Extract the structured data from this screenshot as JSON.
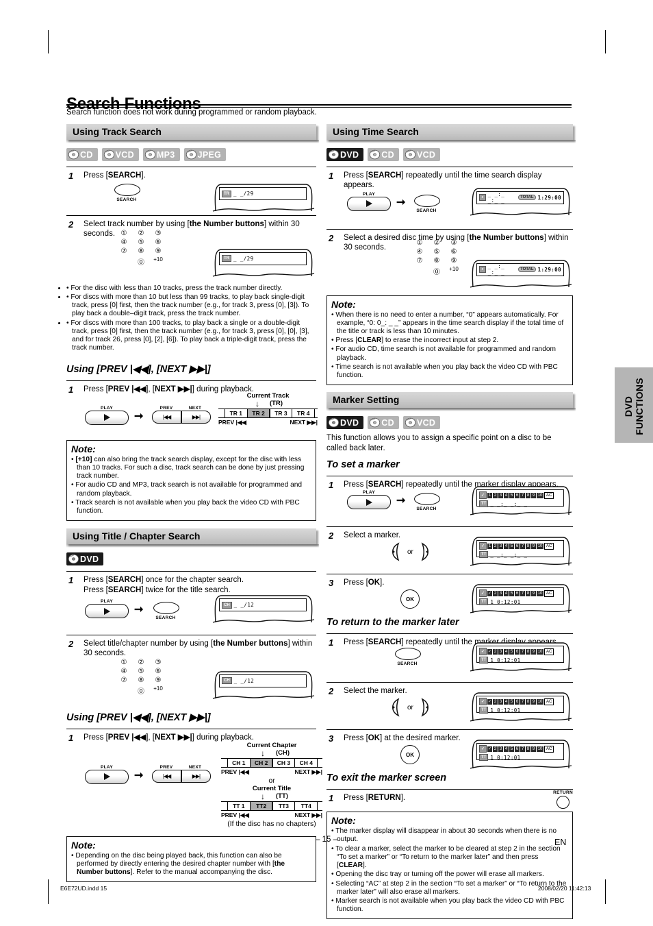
{
  "page": {
    "title": "Search Functions",
    "intro": "Search function does not work during programmed or random playback.",
    "page_number": "– 15 –",
    "language_mark": "EN",
    "side_tab": "DVD FUNCTIONS",
    "footer_left": "E6E72UD.indd   15",
    "footer_right": "2008/02/20   11:42:13"
  },
  "keypad": {
    "keys": [
      "①",
      "②",
      "③",
      "④",
      "⑤",
      "⑥",
      "⑦",
      "⑧",
      "⑨",
      "⓪",
      "+10"
    ]
  },
  "left": {
    "track_search": {
      "heading": "Using Track Search",
      "discs": [
        "CD",
        "VCD",
        "MP3",
        "JPEG"
      ],
      "step1": {
        "num": "1",
        "text_html": "Press [<b>SEARCH</b>].",
        "button_label": "SEARCH",
        "display": {
          "tag": "TR",
          "value": "_ _/29"
        }
      },
      "step2": {
        "num": "2",
        "text_html": "Select track number by using [<b>the Number buttons</b>] within 30 seconds.",
        "display": {
          "tag": "TR",
          "value": "_ _/29"
        }
      },
      "bullets": [
        "For the disc with less than 10 tracks, press the track number directly.",
        "For discs with more than 10 but less than 99 tracks, to play back single-digit track, press [0] first, then the track number (e.g., for track 3, press [0], [3]). To play back a double–digit track, press the track number.",
        "For discs with more than 100 tracks, to play back a single or a double-digit track, press [0] first, then the track number (e.g., for track 3, press [0], [0], [3], and for track 26, press [0], [2], [6]). To play back a triple-digit track, press the track number."
      ]
    },
    "prev_next_track": {
      "heading": "Using [PREV |◀◀], [NEXT ▶▶|]",
      "step1": {
        "num": "1",
        "text_html": "Press [<b>PREV |◀◀</b>], [<b>NEXT ▶▶|</b>] during playback.",
        "play_label": "PLAY",
        "prev_label": "PREV",
        "next_label": "NEXT"
      },
      "diagram": {
        "caption_top": "Current Track",
        "caption_sub": "(TR)",
        "cells": [
          "TR 1",
          "TR 2",
          "TR 3",
          "TR 4"
        ],
        "current_index": 1,
        "left_label": "PREV |◀◀",
        "right_label": "NEXT ▶▶|"
      },
      "note": {
        "title": "Note:",
        "items": [
          "[+10] can also bring the track search display, except for the disc with less than 10 tracks. For such a disc, track search can be done by just pressing track number.",
          "For audio CD and MP3, track search is not available for programmed and random playback.",
          "Track search is not available when you play back the video CD with PBC function."
        ]
      }
    },
    "title_chapter_search": {
      "heading": "Using Title / Chapter Search",
      "discs": [
        "DVD"
      ],
      "step1": {
        "num": "1",
        "text_html": "Press [<b>SEARCH</b>] once for the chapter search.<br>Press [<b>SEARCH</b>] twice for the title search.",
        "play_label": "PLAY",
        "button_label": "SEARCH",
        "display": {
          "tag": "CH",
          "value": "_ _/12"
        }
      },
      "step2": {
        "num": "2",
        "text_html": "Select title/chapter number by using [<b>the Number buttons</b>] within 30 seconds.",
        "display": {
          "tag": "CH",
          "value": "_ _/12"
        }
      }
    },
    "prev_next_chapter": {
      "heading": "Using [PREV |◀◀], [NEXT ▶▶|]",
      "step1": {
        "num": "1",
        "text_html": "Press [<b>PREV |◀◀</b>], [<b>NEXT ▶▶|</b>] during playback.",
        "play_label": "PLAY",
        "prev_label": "PREV",
        "next_label": "NEXT"
      },
      "diagram_chapter": {
        "caption_top": "Current Chapter",
        "caption_sub": "(CH)",
        "cells": [
          "CH 1",
          "CH 2",
          "CH 3",
          "CH 4"
        ],
        "current_index": 1,
        "left_label": "PREV |◀◀",
        "right_label": "NEXT ▶▶|"
      },
      "or_label": "or",
      "diagram_title": {
        "caption_top": "Current Title",
        "caption_sub": "(TT)",
        "cells": [
          "TT 1",
          "TT2",
          "TT3",
          "TT4"
        ],
        "current_index": 1,
        "left_label": "PREV |◀◀",
        "right_label": "NEXT ▶▶|",
        "footnote": "(If the disc has no chapters)"
      },
      "note": {
        "title": "Note:",
        "items": [
          "Depending on the disc being played back, this function can also be performed by directly entering the desired chapter number with [the Number buttons]. Refer to the manual accompanying the disc."
        ]
      }
    }
  },
  "right": {
    "time_search": {
      "heading": "Using Time Search",
      "discs": [
        "DVD",
        "CD",
        "VCD"
      ],
      "step1": {
        "num": "1",
        "text_html": "Press [<b>SEARCH</b>] repeatedly until the time search display appears.",
        "play_label": "PLAY",
        "button_label": "SEARCH",
        "display": {
          "tag": "clock",
          "value": "_ _:_ _:_ _",
          "total_label": "TOTAL",
          "total_value": "1:29:00"
        }
      },
      "step2": {
        "num": "2",
        "text_html": "Select a desired disc time by using [<b>the Number buttons</b>] within 30 seconds.",
        "display": {
          "tag": "clock",
          "value": "_ _:_ _:_ _",
          "total_label": "TOTAL",
          "total_value": "1:29:00"
        }
      },
      "note": {
        "title": "Note:",
        "items": [
          "When there is no need to enter a number, “0” appears automatically. For example, “0: 0_: _ _” appears in the time search display if the total time of the title or track is less than 10 minutes.",
          "Press [CLEAR] to erase the incorrect input at step 2.",
          "For audio CD, time search is not available for programmed and random playback.",
          "Time search is not available when you play back the video CD with PBC function."
        ]
      }
    },
    "marker_setting": {
      "heading": "Marker Setting",
      "discs": [
        "DVD",
        "CD",
        "VCD"
      ],
      "intro": "This function allows you to assign a specific point on a disc to be called back later.",
      "to_set": {
        "heading": "To set a marker",
        "steps": [
          {
            "num": "1",
            "text_html": "Press [<b>SEARCH</b>] repeatedly until the marker display appears.",
            "play_label": "PLAY",
            "button_label": "SEARCH",
            "display": {
              "markers": [
                "1",
                "2",
                "3",
                "4",
                "5",
                "6",
                "7",
                "8",
                "9",
                "10"
              ],
              "ac": "AC",
              "tag": "TT",
              "time": "_ _:_ _:_ _"
            }
          },
          {
            "num": "2",
            "text_html": "Select a marker.",
            "or_label": "or",
            "display": {
              "markers": [
                "1",
                "2",
                "3",
                "4",
                "5",
                "6",
                "7",
                "8",
                "9",
                "10"
              ],
              "ac": "AC",
              "tag": "TT",
              "time": "_ _:_ _:_ _"
            }
          },
          {
            "num": "3",
            "text_html": "Press [<b>OK</b>].",
            "button_label": "OK",
            "display": {
              "markers": [
                "✓",
                "2",
                "3",
                "4",
                "5",
                "6",
                "7",
                "8",
                "9",
                "10"
              ],
              "ac": "AC",
              "tag": "TT",
              "time": "1  0:12:01"
            }
          }
        ]
      },
      "to_return": {
        "heading": "To return to the marker later",
        "steps": [
          {
            "num": "1",
            "text_html": "Press [<b>SEARCH</b>] repeatedly until the marker display appears.",
            "button_label": "SEARCH",
            "display": {
              "markers": [
                "✓",
                "2",
                "3",
                "4",
                "5",
                "6",
                "7",
                "8",
                "9",
                "10"
              ],
              "ac": "AC",
              "tag": "TT",
              "time": "1  0:12:01"
            }
          },
          {
            "num": "2",
            "text_html": "Select the marker.",
            "or_label": "or",
            "display": {
              "markers": [
                "✓",
                "2",
                "3",
                "4",
                "5",
                "6",
                "7",
                "8",
                "9",
                "10"
              ],
              "ac": "AC",
              "tag": "TT",
              "time": "1  0:12:01"
            }
          },
          {
            "num": "3",
            "text_html": "Press [<b>OK</b>] at the desired marker.",
            "button_label": "OK",
            "display": {
              "markers": [
                "✓",
                "2",
                "3",
                "4",
                "5",
                "6",
                "7",
                "8",
                "9",
                "10"
              ],
              "ac": "AC",
              "tag": "TT",
              "time": "1  0:12:01"
            }
          }
        ]
      },
      "to_exit": {
        "heading": "To exit the marker screen",
        "step1": {
          "num": "1",
          "text_html": "Press [<b>RETURN</b>].",
          "button_label": "RETURN"
        }
      },
      "note": {
        "title": "Note:",
        "items": [
          "The marker display will disappear in about 30 seconds when there is no output.",
          "To clear a marker, select the marker to be cleared at step 2 in the section “To set a marker” or “To return to the marker later” and then press [CLEAR].",
          "Opening the disc tray or turning off the power will erase all markers.",
          "Selecting “AC” at step 2 in the section “To set a marker” or “To return to the marker later” will also erase all markers.",
          "Marker search is not available when you play back the video CD with PBC function."
        ]
      }
    }
  }
}
